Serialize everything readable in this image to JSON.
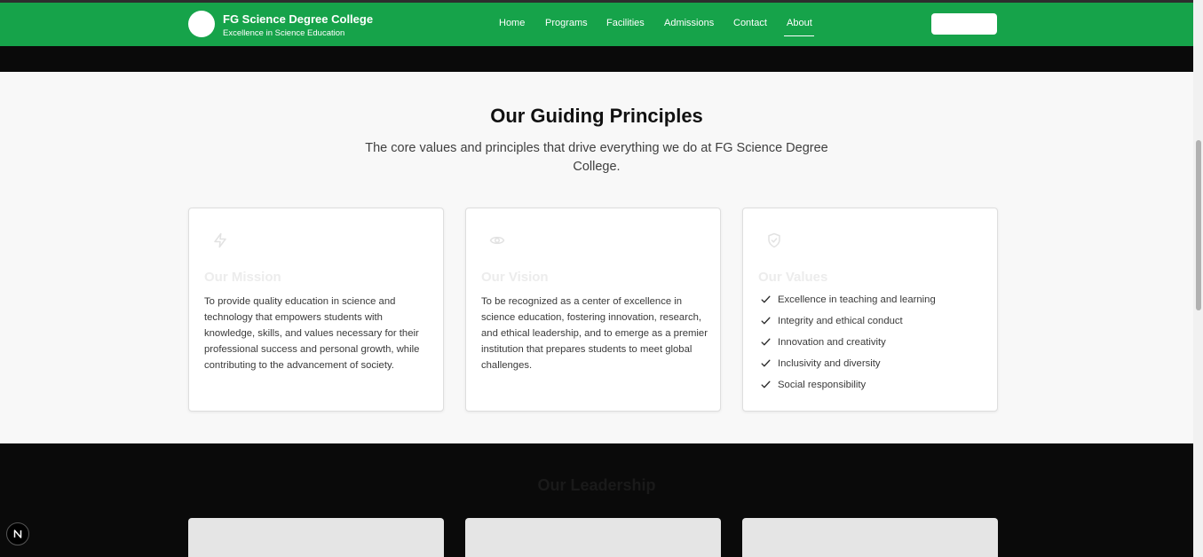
{
  "header": {
    "brand_title": "FG Science Degree College",
    "brand_subtitle": "Excellence in Science Education",
    "nav_items": [
      "Home",
      "Programs",
      "Facilities",
      "Admissions",
      "Contact",
      "About"
    ],
    "active_nav": "About",
    "accent_color": "#16a34a"
  },
  "principles": {
    "title": "Our Guiding Principles",
    "subtitle": "The core values and principles that drive everything we do at FG Science Degree College.",
    "cards": [
      {
        "icon": "lightning-icon",
        "title": "Our Mission",
        "text": "To provide quality education in science and technology that empowers students with knowledge, skills, and values necessary for their professional success and personal growth, while contributing to the advancement of society."
      },
      {
        "icon": "eye-icon",
        "title": "Our Vision",
        "text": "To be recognized as a center of excellence in science education, fostering innovation, research, and ethical leadership, and to emerge as a premier institution that prepares students to meet global challenges."
      },
      {
        "icon": "shield-check-icon",
        "title": "Our Values",
        "items": [
          "Excellence in teaching and learning",
          "Integrity and ethical conduct",
          "Innovation and creativity",
          "Inclusivity and diversity",
          "Social responsibility"
        ]
      }
    ]
  },
  "leadership": {
    "title": "Our Leadership"
  },
  "dev_badge": {
    "letter": "N"
  }
}
